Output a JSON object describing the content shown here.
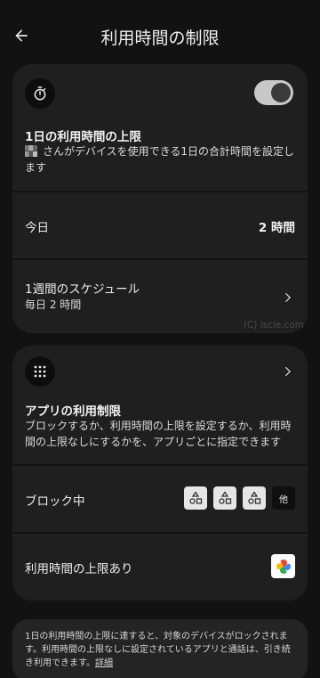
{
  "header": {
    "title": "利用時間の制限"
  },
  "daily_limit": {
    "title": "1日の利用時間の上限",
    "description": "さんがデバイスを使用できる1日の合計時間を設定します",
    "toggle_on": true,
    "icon": "timer-icon"
  },
  "today": {
    "label": "今日",
    "value": "2 時間"
  },
  "schedule": {
    "title": "1週間のスケジュール",
    "subtitle": "毎日 2 時間"
  },
  "watermark": "(C) iscle.com",
  "app_limits": {
    "title": "アプリの利用制限",
    "description": "ブロックするか、利用時間の上限を設定するか、利用時間の上限なしにするかを、アプリごとに指定できます",
    "icon": "apps-grid-icon"
  },
  "blocked": {
    "label": "ブロック中",
    "more_label": "他"
  },
  "limited": {
    "label": "利用時間の上限あり",
    "app_icon": "pinwheel-photos-icon"
  },
  "footer": {
    "text": "1日の利用時間の上限に達すると、対象のデバイスがロックされます。利用時間の上限なしに設定されているアプリと通話は、引き続き利用できます。",
    "link": "詳細"
  },
  "colors": {
    "background": "#121212",
    "card": "#1f1f1f",
    "toggle_track": "#c8c8c8"
  }
}
